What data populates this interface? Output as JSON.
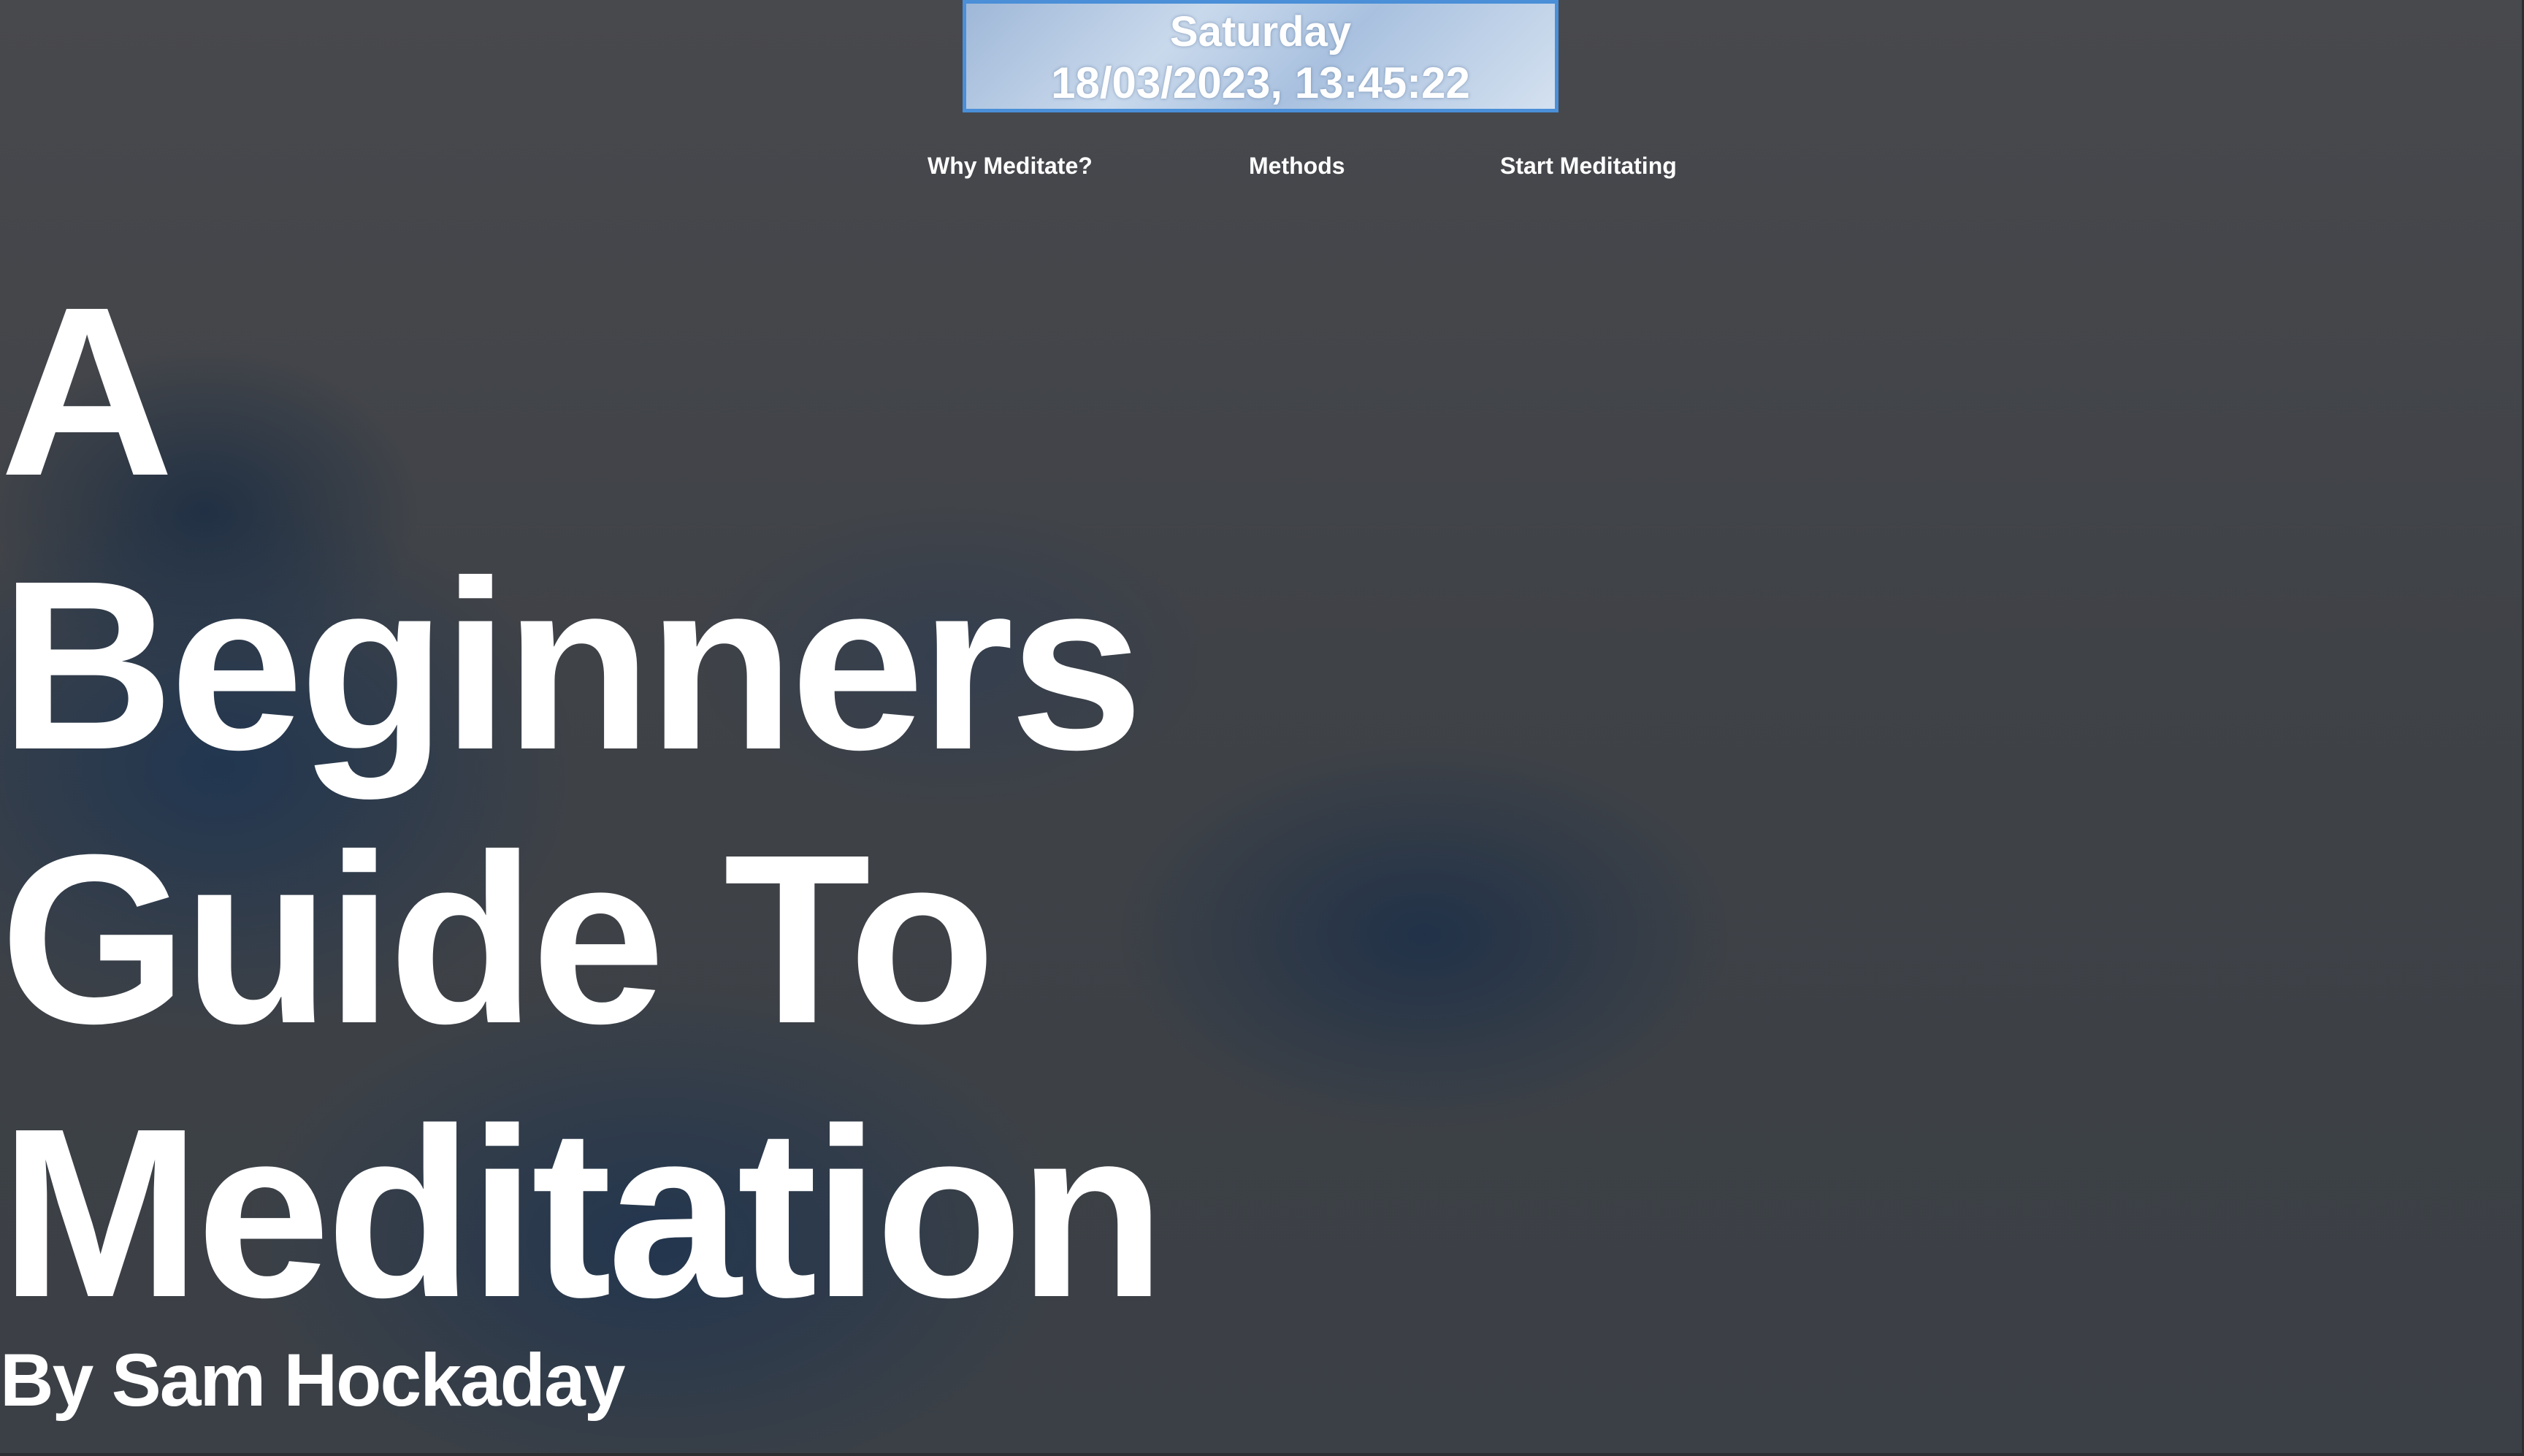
{
  "clock": {
    "day": "Saturday",
    "datetime": "18/03/2023, 13:45:22"
  },
  "nav": {
    "items": [
      {
        "label": "Why Meditate?"
      },
      {
        "label": "Methods"
      },
      {
        "label": "Start Meditating"
      }
    ]
  },
  "hero": {
    "title_lines": [
      "A",
      "Beginners",
      "Guide To",
      "Meditation"
    ],
    "byline": "By Sam Hockaday"
  },
  "colors": {
    "text": "#ffffff",
    "clock_border": "#4a8fd8",
    "background": "#3f4146",
    "cloud_blue": "#1c3452"
  }
}
